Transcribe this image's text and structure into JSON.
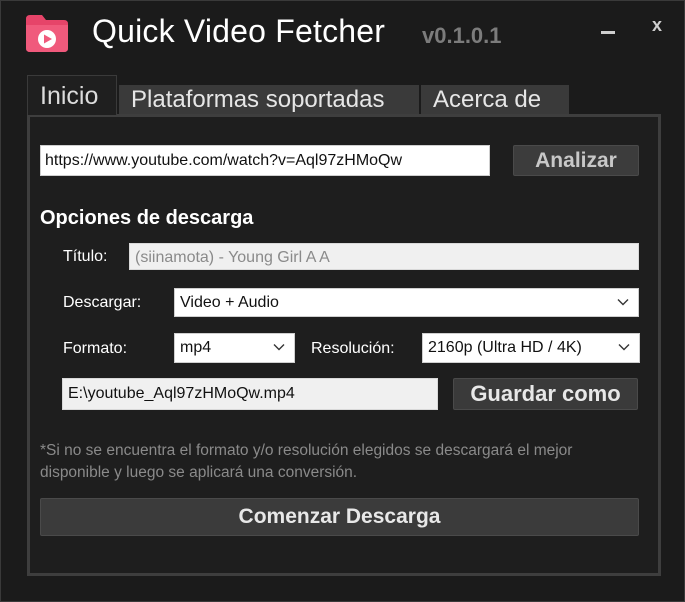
{
  "window": {
    "title": "Quick Video Fetcher",
    "version": "v0.1.0.1",
    "minimize_label": "—",
    "close_label": "x",
    "accent_color": "#f0466e"
  },
  "tabs": [
    {
      "label": "Inicio",
      "active": true
    },
    {
      "label": "Plataformas soportadas",
      "active": false
    },
    {
      "label": "Acerca de",
      "active": false
    }
  ],
  "main": {
    "url_value": "https://www.youtube.com/watch?v=Aql97zHMoQw",
    "analyze_label": "Analizar",
    "section_title": "Opciones de descarga",
    "title_label": "Título:",
    "title_value": "(siinamota) - Young Girl A  A",
    "download_label": "Descargar:",
    "download_value": "Video + Audio",
    "format_label": "Formato:",
    "format_value": "mp4",
    "resolution_label": "Resolución:",
    "resolution_value": "2160p (Ultra HD / 4K)",
    "path_value": "E:\\youtube_Aql97zHMoQw.mp4",
    "save_label": "Guardar como",
    "note": "*Si no se encuentra el formato y/o resolución elegidos se descargará el mejor disponible y luego se aplicará una conversión.",
    "start_label": "Comenzar Descarga"
  }
}
